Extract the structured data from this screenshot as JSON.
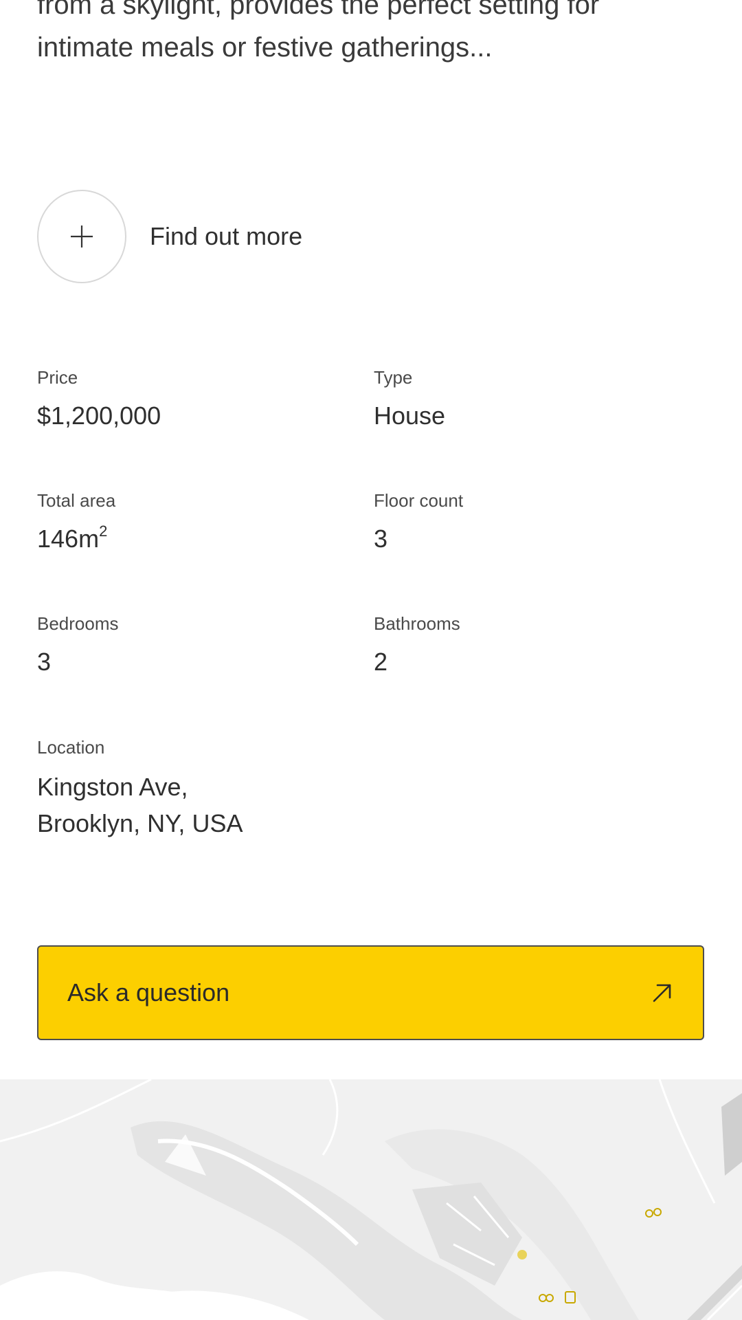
{
  "description": {
    "lines": [
      "from a skylight, provides the perfect setting for",
      "intimate meals or festive gatherings..."
    ]
  },
  "find_more": {
    "label": "Find out more",
    "icon": "plus-icon"
  },
  "specs": [
    {
      "label": "Price",
      "value": "$1,200,000"
    },
    {
      "label": "Type",
      "value": "House"
    },
    {
      "label": "Total area",
      "value": "146m",
      "superscript": "2"
    },
    {
      "label": "Floor count",
      "value": "3"
    },
    {
      "label": "Bedrooms",
      "value": "3"
    },
    {
      "label": "Bathrooms",
      "value": "2"
    }
  ],
  "location": {
    "label": "Location",
    "lines": [
      "Kingston Ave,",
      "Brooklyn, NY, USA"
    ]
  },
  "ask_button": {
    "label": "Ask a question",
    "icon": "arrow-up-right-icon"
  },
  "colors": {
    "accent": "#fccf00",
    "text": "#2f2f2f",
    "map_bg": "#f1f1f1"
  }
}
